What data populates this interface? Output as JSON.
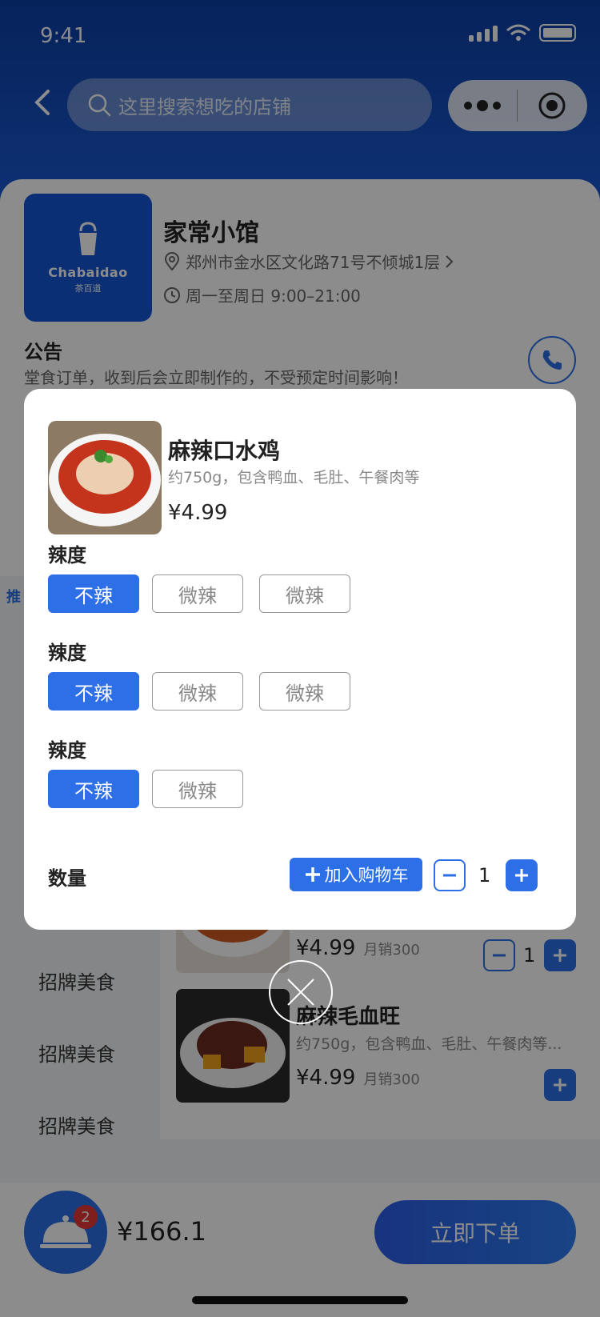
{
  "status_bar": {
    "time": "9:41"
  },
  "search": {
    "placeholder": "这里搜索想吃的店铺"
  },
  "store": {
    "name": "家常小馆",
    "logo_brand": "Chabaidao",
    "logo_brand_cn": "茶百道",
    "address": "郑州市金水区文化路71号不倾城1层",
    "hours": "周一至周日 9:00–21:00",
    "notice_title": "公告",
    "notice_text": "堂食订单，收到后会立即制作的，不受预定时间影响！"
  },
  "menu": {
    "tag": "推",
    "categories": [
      "招牌美食",
      "招牌美食",
      "招牌美食"
    ],
    "dishes": [
      {
        "price": "¥4.99",
        "sales": "月销300",
        "qty": "1"
      },
      {
        "name": "麻辣毛血旺",
        "desc": "约750g，包含鸭血、毛肚、午餐肉等...",
        "price": "¥4.99",
        "sales": "月销300"
      }
    ]
  },
  "modal": {
    "name": "麻辣口水鸡",
    "desc": "约750g，包含鸭血、毛肚、午餐肉等",
    "price": "¥4.99",
    "option_groups": [
      {
        "label": "辣度",
        "options": [
          "不辣",
          "微辣",
          "微辣"
        ],
        "selected": 0
      },
      {
        "label": "辣度",
        "options": [
          "不辣",
          "微辣",
          "微辣"
        ],
        "selected": 0
      },
      {
        "label": "辣度",
        "options": [
          "不辣",
          "微辣"
        ],
        "selected": 0
      }
    ],
    "qty_label": "数量",
    "add_cart_label": "加入购物车",
    "qty": "1"
  },
  "cart": {
    "badge": "2",
    "total": "¥166.1"
  },
  "order_button": "立即下单",
  "colors": {
    "accent": "#2c6fe6",
    "header": "#1556d6",
    "badge": "#e53935"
  }
}
